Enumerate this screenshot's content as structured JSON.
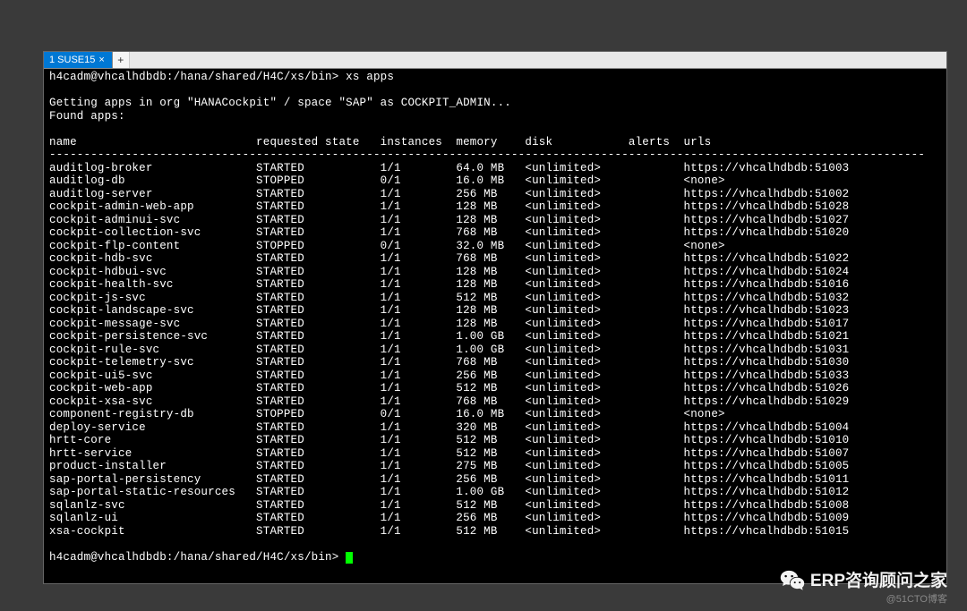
{
  "tab": {
    "label": "1 SUSE15",
    "close": "×",
    "add": "+"
  },
  "prompt1": "h4cadm@vhcalhdbdb:/hana/shared/H4C/xs/bin> xs apps",
  "status_line": "Getting apps in org \"HANACockpit\" / space \"SAP\" as COCKPIT_ADMIN...",
  "found_line": "Found apps:",
  "headers": {
    "name": "name",
    "requested_state": "requested state",
    "instances": "instances",
    "memory": "memory",
    "disk": "disk",
    "alerts": "alerts",
    "urls": "urls"
  },
  "apps": [
    {
      "name": "auditlog-broker",
      "state": "STARTED",
      "instances": "1/1",
      "memory": "64.0 MB",
      "disk": "<unlimited>",
      "alerts": "",
      "url": "https://vhcalhdbdb:51003"
    },
    {
      "name": "auditlog-db",
      "state": "STOPPED",
      "instances": "0/1",
      "memory": "16.0 MB",
      "disk": "<unlimited>",
      "alerts": "",
      "url": "<none>"
    },
    {
      "name": "auditlog-server",
      "state": "STARTED",
      "instances": "1/1",
      "memory": "256 MB",
      "disk": "<unlimited>",
      "alerts": "",
      "url": "https://vhcalhdbdb:51002"
    },
    {
      "name": "cockpit-admin-web-app",
      "state": "STARTED",
      "instances": "1/1",
      "memory": "128 MB",
      "disk": "<unlimited>",
      "alerts": "",
      "url": "https://vhcalhdbdb:51028"
    },
    {
      "name": "cockpit-adminui-svc",
      "state": "STARTED",
      "instances": "1/1",
      "memory": "128 MB",
      "disk": "<unlimited>",
      "alerts": "",
      "url": "https://vhcalhdbdb:51027"
    },
    {
      "name": "cockpit-collection-svc",
      "state": "STARTED",
      "instances": "1/1",
      "memory": "768 MB",
      "disk": "<unlimited>",
      "alerts": "",
      "url": "https://vhcalhdbdb:51020"
    },
    {
      "name": "cockpit-flp-content",
      "state": "STOPPED",
      "instances": "0/1",
      "memory": "32.0 MB",
      "disk": "<unlimited>",
      "alerts": "",
      "url": "<none>"
    },
    {
      "name": "cockpit-hdb-svc",
      "state": "STARTED",
      "instances": "1/1",
      "memory": "768 MB",
      "disk": "<unlimited>",
      "alerts": "",
      "url": "https://vhcalhdbdb:51022"
    },
    {
      "name": "cockpit-hdbui-svc",
      "state": "STARTED",
      "instances": "1/1",
      "memory": "128 MB",
      "disk": "<unlimited>",
      "alerts": "",
      "url": "https://vhcalhdbdb:51024"
    },
    {
      "name": "cockpit-health-svc",
      "state": "STARTED",
      "instances": "1/1",
      "memory": "128 MB",
      "disk": "<unlimited>",
      "alerts": "",
      "url": "https://vhcalhdbdb:51016"
    },
    {
      "name": "cockpit-js-svc",
      "state": "STARTED",
      "instances": "1/1",
      "memory": "512 MB",
      "disk": "<unlimited>",
      "alerts": "",
      "url": "https://vhcalhdbdb:51032"
    },
    {
      "name": "cockpit-landscape-svc",
      "state": "STARTED",
      "instances": "1/1",
      "memory": "128 MB",
      "disk": "<unlimited>",
      "alerts": "",
      "url": "https://vhcalhdbdb:51023"
    },
    {
      "name": "cockpit-message-svc",
      "state": "STARTED",
      "instances": "1/1",
      "memory": "128 MB",
      "disk": "<unlimited>",
      "alerts": "",
      "url": "https://vhcalhdbdb:51017"
    },
    {
      "name": "cockpit-persistence-svc",
      "state": "STARTED",
      "instances": "1/1",
      "memory": "1.00 GB",
      "disk": "<unlimited>",
      "alerts": "",
      "url": "https://vhcalhdbdb:51021"
    },
    {
      "name": "cockpit-rule-svc",
      "state": "STARTED",
      "instances": "1/1",
      "memory": "1.00 GB",
      "disk": "<unlimited>",
      "alerts": "",
      "url": "https://vhcalhdbdb:51031"
    },
    {
      "name": "cockpit-telemetry-svc",
      "state": "STARTED",
      "instances": "1/1",
      "memory": "768 MB",
      "disk": "<unlimited>",
      "alerts": "",
      "url": "https://vhcalhdbdb:51030"
    },
    {
      "name": "cockpit-ui5-svc",
      "state": "STARTED",
      "instances": "1/1",
      "memory": "256 MB",
      "disk": "<unlimited>",
      "alerts": "",
      "url": "https://vhcalhdbdb:51033"
    },
    {
      "name": "cockpit-web-app",
      "state": "STARTED",
      "instances": "1/1",
      "memory": "512 MB",
      "disk": "<unlimited>",
      "alerts": "",
      "url": "https://vhcalhdbdb:51026"
    },
    {
      "name": "cockpit-xsa-svc",
      "state": "STARTED",
      "instances": "1/1",
      "memory": "768 MB",
      "disk": "<unlimited>",
      "alerts": "",
      "url": "https://vhcalhdbdb:51029"
    },
    {
      "name": "component-registry-db",
      "state": "STOPPED",
      "instances": "0/1",
      "memory": "16.0 MB",
      "disk": "<unlimited>",
      "alerts": "",
      "url": "<none>"
    },
    {
      "name": "deploy-service",
      "state": "STARTED",
      "instances": "1/1",
      "memory": "320 MB",
      "disk": "<unlimited>",
      "alerts": "",
      "url": "https://vhcalhdbdb:51004"
    },
    {
      "name": "hrtt-core",
      "state": "STARTED",
      "instances": "1/1",
      "memory": "512 MB",
      "disk": "<unlimited>",
      "alerts": "",
      "url": "https://vhcalhdbdb:51010"
    },
    {
      "name": "hrtt-service",
      "state": "STARTED",
      "instances": "1/1",
      "memory": "512 MB",
      "disk": "<unlimited>",
      "alerts": "",
      "url": "https://vhcalhdbdb:51007"
    },
    {
      "name": "product-installer",
      "state": "STARTED",
      "instances": "1/1",
      "memory": "275 MB",
      "disk": "<unlimited>",
      "alerts": "",
      "url": "https://vhcalhdbdb:51005"
    },
    {
      "name": "sap-portal-persistency",
      "state": "STARTED",
      "instances": "1/1",
      "memory": "256 MB",
      "disk": "<unlimited>",
      "alerts": "",
      "url": "https://vhcalhdbdb:51011"
    },
    {
      "name": "sap-portal-static-resources",
      "state": "STARTED",
      "instances": "1/1",
      "memory": "1.00 GB",
      "disk": "<unlimited>",
      "alerts": "",
      "url": "https://vhcalhdbdb:51012"
    },
    {
      "name": "sqlanlz-svc",
      "state": "STARTED",
      "instances": "1/1",
      "memory": "512 MB",
      "disk": "<unlimited>",
      "alerts": "",
      "url": "https://vhcalhdbdb:51008"
    },
    {
      "name": "sqlanlz-ui",
      "state": "STARTED",
      "instances": "1/1",
      "memory": "256 MB",
      "disk": "<unlimited>",
      "alerts": "",
      "url": "https://vhcalhdbdb:51009"
    },
    {
      "name": "xsa-cockpit",
      "state": "STARTED",
      "instances": "1/1",
      "memory": "512 MB",
      "disk": "<unlimited>",
      "alerts": "",
      "url": "https://vhcalhdbdb:51015"
    }
  ],
  "prompt2": "h4cadm@vhcalhdbdb:/hana/shared/H4C/xs/bin> ",
  "watermark_text": "ERP咨询顾问之家",
  "attribution": "@51CTO博客"
}
